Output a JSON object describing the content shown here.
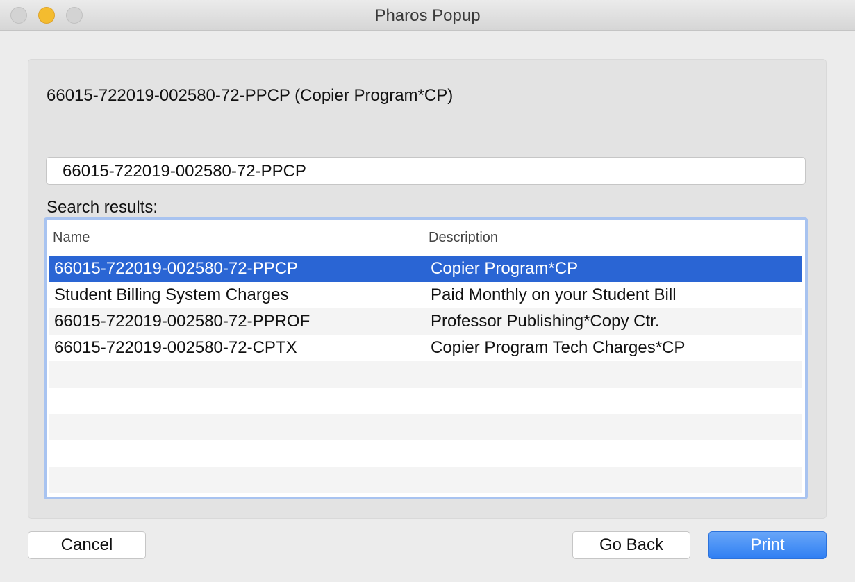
{
  "window": {
    "title": "Pharos Popup"
  },
  "account": {
    "heading": "66015-722019-002580-72-PPCP (Copier Program*CP)"
  },
  "search": {
    "value": "66015-722019-002580-72-PPCP"
  },
  "results": {
    "label": "Search results:",
    "columns": [
      "Name",
      "Description"
    ],
    "rows": [
      {
        "name": "66015-722019-002580-72-PPCP",
        "description": "Copier Program*CP",
        "selected": true
      },
      {
        "name": "Student Billing System Charges",
        "description": "Paid Monthly on your Student Bill",
        "selected": false
      },
      {
        "name": "66015-722019-002580-72-PPROF",
        "description": "Professor Publishing*Copy Ctr.",
        "selected": false
      },
      {
        "name": "66015-722019-002580-72-CPTX",
        "description": "Copier Program Tech Charges*CP",
        "selected": false
      }
    ]
  },
  "buttons": {
    "cancel": "Cancel",
    "go_back": "Go Back",
    "print": "Print"
  },
  "colors": {
    "selection": "#2a65d4",
    "primary_button": "#2f7ff3",
    "focus_ring": "#a8c3f0",
    "minimize": "#f4bc2f"
  }
}
